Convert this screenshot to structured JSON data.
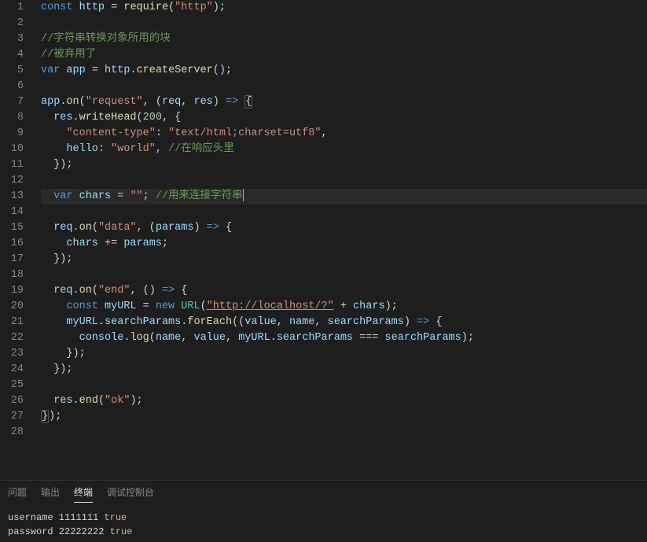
{
  "editor": {
    "line_count": 28,
    "current_line": 13,
    "lines": [
      [
        {
          "c": "tok-kw",
          "t": "const"
        },
        {
          "c": "tok-op",
          "t": " "
        },
        {
          "c": "tok-var",
          "t": "http"
        },
        {
          "c": "tok-op",
          "t": " = "
        },
        {
          "c": "tok-fn",
          "t": "require"
        },
        {
          "c": "tok-pn",
          "t": "("
        },
        {
          "c": "tok-str",
          "t": "\"http\""
        },
        {
          "c": "tok-pn",
          "t": ");"
        }
      ],
      [],
      [
        {
          "c": "tok-cmt",
          "t": "//字符串转换对象所用的块"
        }
      ],
      [
        {
          "c": "tok-cmt",
          "t": "//被弃用了"
        }
      ],
      [
        {
          "c": "tok-kw",
          "t": "var"
        },
        {
          "c": "tok-op",
          "t": " "
        },
        {
          "c": "tok-var",
          "t": "app"
        },
        {
          "c": "tok-op",
          "t": " = "
        },
        {
          "c": "tok-var",
          "t": "http"
        },
        {
          "c": "tok-pn",
          "t": "."
        },
        {
          "c": "tok-fn",
          "t": "createServer"
        },
        {
          "c": "tok-pn",
          "t": "();"
        }
      ],
      [],
      [
        {
          "c": "tok-var",
          "t": "app"
        },
        {
          "c": "tok-pn",
          "t": "."
        },
        {
          "c": "tok-fn",
          "t": "on"
        },
        {
          "c": "tok-pn",
          "t": "("
        },
        {
          "c": "tok-str",
          "t": "\"request\""
        },
        {
          "c": "tok-pn",
          "t": ", ("
        },
        {
          "c": "tok-var",
          "t": "req"
        },
        {
          "c": "tok-pn",
          "t": ", "
        },
        {
          "c": "tok-var",
          "t": "res"
        },
        {
          "c": "tok-pn",
          "t": ") "
        },
        {
          "c": "tok-kw",
          "t": "=>"
        },
        {
          "c": "tok-pn",
          "t": " "
        },
        {
          "c": "tok-pn brace-hl",
          "t": "{"
        }
      ],
      [
        {
          "c": "tok-op",
          "t": "  "
        },
        {
          "c": "tok-var",
          "t": "res"
        },
        {
          "c": "tok-pn",
          "t": "."
        },
        {
          "c": "tok-fn",
          "t": "writeHead"
        },
        {
          "c": "tok-pn",
          "t": "("
        },
        {
          "c": "tok-num",
          "t": "200"
        },
        {
          "c": "tok-pn",
          "t": ", {"
        }
      ],
      [
        {
          "c": "tok-op",
          "t": "    "
        },
        {
          "c": "tok-str",
          "t": "\"content-type\""
        },
        {
          "c": "tok-pn",
          "t": ": "
        },
        {
          "c": "tok-str",
          "t": "\"text/html;charset=utf8\""
        },
        {
          "c": "tok-pn",
          "t": ","
        }
      ],
      [
        {
          "c": "tok-op",
          "t": "    "
        },
        {
          "c": "tok-prop",
          "t": "hello"
        },
        {
          "c": "tok-pn",
          "t": ": "
        },
        {
          "c": "tok-str",
          "t": "\"world\""
        },
        {
          "c": "tok-pn",
          "t": ", "
        },
        {
          "c": "tok-cmt",
          "t": "//在响应头里"
        }
      ],
      [
        {
          "c": "tok-op",
          "t": "  "
        },
        {
          "c": "tok-pn",
          "t": "});"
        }
      ],
      [],
      [
        {
          "c": "tok-op",
          "t": "  "
        },
        {
          "c": "tok-kw",
          "t": "var"
        },
        {
          "c": "tok-op",
          "t": " "
        },
        {
          "c": "tok-var",
          "t": "chars"
        },
        {
          "c": "tok-op",
          "t": " = "
        },
        {
          "c": "tok-str",
          "t": "\"\""
        },
        {
          "c": "tok-pn",
          "t": "; "
        },
        {
          "c": "tok-cmt",
          "t": "//用来连接字符串"
        }
      ],
      [],
      [
        {
          "c": "tok-op",
          "t": "  "
        },
        {
          "c": "tok-var",
          "t": "req"
        },
        {
          "c": "tok-pn",
          "t": "."
        },
        {
          "c": "tok-fn",
          "t": "on"
        },
        {
          "c": "tok-pn",
          "t": "("
        },
        {
          "c": "tok-str",
          "t": "\"data\""
        },
        {
          "c": "tok-pn",
          "t": ", ("
        },
        {
          "c": "tok-var",
          "t": "params"
        },
        {
          "c": "tok-pn",
          "t": ") "
        },
        {
          "c": "tok-kw",
          "t": "=>"
        },
        {
          "c": "tok-pn",
          "t": " {"
        }
      ],
      [
        {
          "c": "tok-op",
          "t": "    "
        },
        {
          "c": "tok-var",
          "t": "chars"
        },
        {
          "c": "tok-op",
          "t": " += "
        },
        {
          "c": "tok-var",
          "t": "params"
        },
        {
          "c": "tok-pn",
          "t": ";"
        }
      ],
      [
        {
          "c": "tok-op",
          "t": "  "
        },
        {
          "c": "tok-pn",
          "t": "});"
        }
      ],
      [],
      [
        {
          "c": "tok-op",
          "t": "  "
        },
        {
          "c": "tok-var",
          "t": "req"
        },
        {
          "c": "tok-pn",
          "t": "."
        },
        {
          "c": "tok-fn",
          "t": "on"
        },
        {
          "c": "tok-pn",
          "t": "("
        },
        {
          "c": "tok-str",
          "t": "\"end\""
        },
        {
          "c": "tok-pn",
          "t": ", () "
        },
        {
          "c": "tok-kw",
          "t": "=>"
        },
        {
          "c": "tok-pn",
          "t": " {"
        }
      ],
      [
        {
          "c": "tok-op",
          "t": "    "
        },
        {
          "c": "tok-kw",
          "t": "const"
        },
        {
          "c": "tok-op",
          "t": " "
        },
        {
          "c": "tok-var",
          "t": "myURL"
        },
        {
          "c": "tok-op",
          "t": " = "
        },
        {
          "c": "tok-kw",
          "t": "new"
        },
        {
          "c": "tok-op",
          "t": " "
        },
        {
          "c": "tok-cls",
          "t": "URL"
        },
        {
          "c": "tok-pn",
          "t": "("
        },
        {
          "c": "tok-str underline",
          "t": "\"http://localhost/?\""
        },
        {
          "c": "tok-op",
          "t": " + "
        },
        {
          "c": "tok-var",
          "t": "chars"
        },
        {
          "c": "tok-pn",
          "t": ");"
        }
      ],
      [
        {
          "c": "tok-op",
          "t": "    "
        },
        {
          "c": "tok-var",
          "t": "myURL"
        },
        {
          "c": "tok-pn",
          "t": "."
        },
        {
          "c": "tok-prop",
          "t": "searchParams"
        },
        {
          "c": "tok-pn",
          "t": "."
        },
        {
          "c": "tok-fn",
          "t": "forEach"
        },
        {
          "c": "tok-pn",
          "t": "(("
        },
        {
          "c": "tok-var",
          "t": "value"
        },
        {
          "c": "tok-pn",
          "t": ", "
        },
        {
          "c": "tok-var",
          "t": "name"
        },
        {
          "c": "tok-pn",
          "t": ", "
        },
        {
          "c": "tok-var",
          "t": "searchParams"
        },
        {
          "c": "tok-pn",
          "t": ") "
        },
        {
          "c": "tok-kw",
          "t": "=>"
        },
        {
          "c": "tok-pn",
          "t": " {"
        }
      ],
      [
        {
          "c": "tok-op",
          "t": "      "
        },
        {
          "c": "tok-var",
          "t": "console"
        },
        {
          "c": "tok-pn",
          "t": "."
        },
        {
          "c": "tok-fn",
          "t": "log"
        },
        {
          "c": "tok-pn",
          "t": "("
        },
        {
          "c": "tok-var",
          "t": "name"
        },
        {
          "c": "tok-pn",
          "t": ", "
        },
        {
          "c": "tok-var",
          "t": "value"
        },
        {
          "c": "tok-pn",
          "t": ", "
        },
        {
          "c": "tok-var",
          "t": "myURL"
        },
        {
          "c": "tok-pn",
          "t": "."
        },
        {
          "c": "tok-prop",
          "t": "searchParams"
        },
        {
          "c": "tok-op",
          "t": " === "
        },
        {
          "c": "tok-var",
          "t": "searchParams"
        },
        {
          "c": "tok-pn",
          "t": ");"
        }
      ],
      [
        {
          "c": "tok-op",
          "t": "    "
        },
        {
          "c": "tok-pn",
          "t": "});"
        }
      ],
      [
        {
          "c": "tok-op",
          "t": "  "
        },
        {
          "c": "tok-pn",
          "t": "});"
        }
      ],
      [],
      [
        {
          "c": "tok-op",
          "t": "  "
        },
        {
          "c": "tok-var",
          "t": "res"
        },
        {
          "c": "tok-pn",
          "t": "."
        },
        {
          "c": "tok-fn",
          "t": "end"
        },
        {
          "c": "tok-pn",
          "t": "("
        },
        {
          "c": "tok-str",
          "t": "\"ok\""
        },
        {
          "c": "tok-pn",
          "t": ");"
        }
      ],
      [
        {
          "c": "tok-pn brace-hl",
          "t": "}"
        },
        {
          "c": "tok-pn",
          "t": ");"
        }
      ],
      []
    ]
  },
  "panel": {
    "tabs": {
      "problems": "问题",
      "output": "输出",
      "terminal": "终端",
      "debug_console": "调试控制台"
    },
    "active_tab": "terminal",
    "terminal_lines": [
      [
        {
          "c": "term-white",
          "t": "username 1111111 "
        },
        {
          "c": "term-yellow",
          "t": "true"
        }
      ],
      [
        {
          "c": "term-white",
          "t": "password 22222222 "
        },
        {
          "c": "term-yellow",
          "t": "true"
        }
      ]
    ]
  }
}
